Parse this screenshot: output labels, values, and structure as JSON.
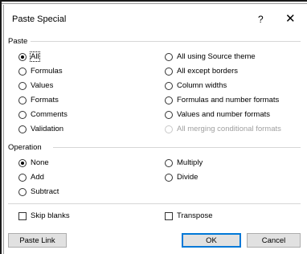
{
  "window": {
    "title": "Paste Special",
    "help": "?",
    "close": "✕"
  },
  "paste": {
    "label": "Paste",
    "left": [
      {
        "label": "All",
        "checked": true
      },
      {
        "label": "Formulas"
      },
      {
        "label": "Values"
      },
      {
        "label": "Formats"
      },
      {
        "label": "Comments"
      },
      {
        "label": "Validation"
      }
    ],
    "right": [
      {
        "label": "All using Source theme"
      },
      {
        "label": "All except borders"
      },
      {
        "label": "Column widths"
      },
      {
        "label": "Formulas and number formats"
      },
      {
        "label": "Values and number formats"
      },
      {
        "label": "All merging conditional formats",
        "disabled": true
      }
    ]
  },
  "operation": {
    "label": "Operation",
    "left": [
      {
        "label": "None",
        "checked": true
      },
      {
        "label": "Add"
      },
      {
        "label": "Subtract"
      }
    ],
    "right": [
      {
        "label": "Multiply"
      },
      {
        "label": "Divide"
      }
    ]
  },
  "checks": {
    "skip_blanks": "Skip blanks",
    "transpose": "Transpose"
  },
  "buttons": {
    "paste_link": "Paste Link",
    "ok": "OK",
    "cancel": "Cancel"
  }
}
